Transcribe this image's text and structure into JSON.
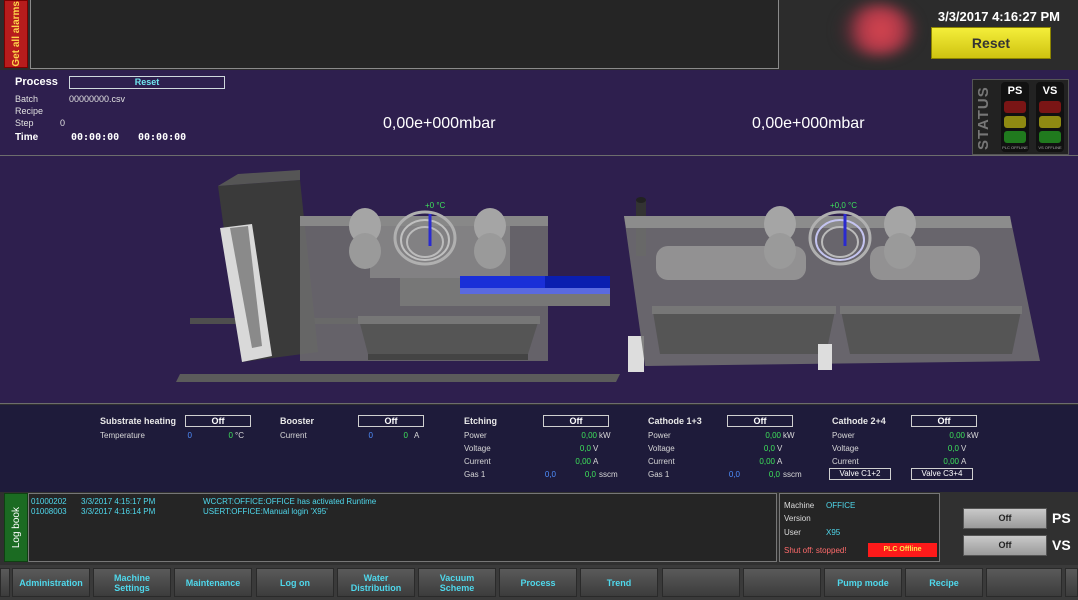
{
  "alarms": {
    "button_label": "Get all alarms"
  },
  "header": {
    "datetime": "3/3/2017 4:16:27 PM",
    "reset_label": "Reset"
  },
  "process": {
    "title": "Process",
    "reset_label": "Reset",
    "batch_label": "Batch",
    "batch_value": "00000000.csv",
    "recipe_label": "Recipe",
    "step_label": "Step",
    "step_value": "0",
    "time_label": "Time",
    "time_elapsed": "00:00:00",
    "time_remaining": "00:00:00"
  },
  "pressure": {
    "left": "0,00e+000mbar",
    "right": "0,00e+000mbar"
  },
  "status": {
    "label": "STATUS",
    "ps": {
      "label": "PS",
      "sub": "PLC OFFLINE"
    },
    "vs": {
      "label": "VS",
      "sub": "VS OFFLINE"
    }
  },
  "scene": {
    "temp_left": "+0 °C",
    "temp_right": "+0,0 °C"
  },
  "groups": {
    "substrate": {
      "title": "Substrate heating",
      "state": "Off",
      "temperature_label": "Temperature",
      "temperature_set": "0",
      "temperature_act": "0",
      "temperature_unit": "°C"
    },
    "booster": {
      "title": "Booster",
      "state": "Off",
      "current_label": "Current",
      "current_set": "0",
      "current_act": "0",
      "current_unit": "A"
    },
    "etching": {
      "title": "Etching",
      "state": "Off",
      "power_label": "Power",
      "power": "0,00",
      "power_unit": "kW",
      "voltage_label": "Voltage",
      "voltage": "0,0",
      "voltage_unit": "V",
      "current_label": "Current",
      "current": "0,00",
      "current_unit": "A",
      "gas_label": "Gas 1",
      "gas_set": "0,0",
      "gas_act": "0,0",
      "gas_unit": "sscm"
    },
    "cathode13": {
      "title": "Cathode 1+3",
      "state": "Off",
      "power_label": "Power",
      "power": "0,00",
      "power_unit": "kW",
      "voltage_label": "Voltage",
      "voltage": "0,0",
      "voltage_unit": "V",
      "current_label": "Current",
      "current": "0,00",
      "current_unit": "A",
      "gas_label": "Gas 1",
      "gas_set": "0,0",
      "gas_act": "0,0",
      "gas_unit": "sscm"
    },
    "cathode24": {
      "title": "Cathode 2+4",
      "state": "Off",
      "power_label": "Power",
      "power": "0,00",
      "power_unit": "kW",
      "voltage_label": "Voltage",
      "voltage": "0,0",
      "voltage_unit": "V",
      "current_label": "Current",
      "current": "0,00",
      "current_unit": "A",
      "valve1": "Valve C1+2",
      "valve2": "Valve C3+4"
    }
  },
  "logbook": {
    "tab_label": "Log book",
    "entries": [
      {
        "code": "01000202",
        "time": "3/3/2017 4:15:17 PM",
        "message": "WCCRT:OFFICE:OFFICE has activated Runtime"
      },
      {
        "code": "01008003",
        "time": "3/3/2017 4:16:14 PM",
        "message": "USERT:OFFICE:Manual login 'X95'"
      }
    ]
  },
  "machine_info": {
    "machine_label": "Machine",
    "machine_value": "OFFICE",
    "version_label": "Version",
    "version_value": "",
    "user_label": "User",
    "user_value": "X95",
    "shutoff": "Shut off: stopped!",
    "plc": "PLC Offline"
  },
  "pumps": {
    "ps_state": "Off",
    "ps_label": "PS",
    "vs_state": "Off",
    "vs_label": "VS"
  },
  "nav": {
    "items": [
      {
        "line1": "",
        "line2": ""
      },
      {
        "line1": "Administration",
        "line2": ""
      },
      {
        "line1": "Machine",
        "line2": "Settings"
      },
      {
        "line1": "Maintenance",
        "line2": ""
      },
      {
        "line1": "Log on",
        "line2": ""
      },
      {
        "line1": "Water",
        "line2": "Distribution"
      },
      {
        "line1": "Vacuum",
        "line2": "Scheme"
      },
      {
        "line1": "Process",
        "line2": ""
      },
      {
        "line1": "Trend",
        "line2": ""
      },
      {
        "line1": "",
        "line2": ""
      },
      {
        "line1": "",
        "line2": ""
      },
      {
        "line1": "Pump mode",
        "line2": ""
      },
      {
        "line1": "Recipe",
        "line2": ""
      },
      {
        "line1": "",
        "line2": ""
      }
    ]
  },
  "colors": {
    "accent_cyan": "#4fd8ec",
    "value_green": "#3ee25b",
    "setpoint_blue": "#4f8fff",
    "alarm_red": "#b71c1c",
    "reset_yellow": "#e8df20",
    "background_purple": "#2e1f4e"
  }
}
